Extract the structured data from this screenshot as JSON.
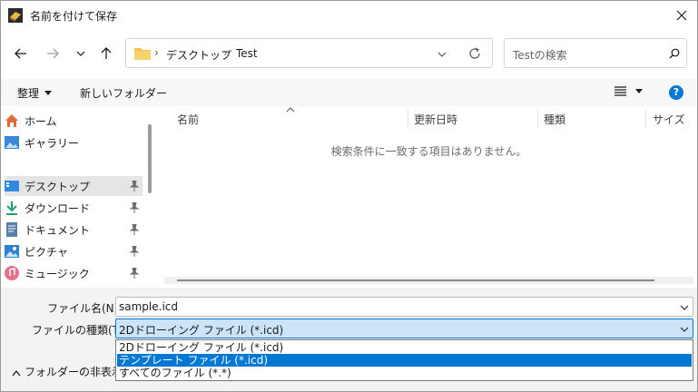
{
  "window": {
    "title": "名前を付けて保存",
    "close_icon": "close-icon"
  },
  "nav": {
    "address": {
      "segments": [
        "デスクトップ",
        "Test"
      ]
    },
    "search": {
      "placeholder": "Testの検索"
    }
  },
  "toolbar": {
    "organize_label": "整理",
    "new_folder_label": "新しいフォルダー"
  },
  "sidebar": {
    "items": [
      {
        "label": "ホーム",
        "icon": "home-icon",
        "pinned": false,
        "selected": false
      },
      {
        "label": "ギャラリー",
        "icon": "gallery-icon",
        "pinned": false,
        "selected": false
      },
      {
        "label": "デスクトップ",
        "icon": "desktop-icon",
        "pinned": true,
        "selected": true
      },
      {
        "label": "ダウンロード",
        "icon": "download-icon",
        "pinned": true,
        "selected": false
      },
      {
        "label": "ドキュメント",
        "icon": "document-icon",
        "pinned": true,
        "selected": false
      },
      {
        "label": "ピクチャ",
        "icon": "pictures-icon",
        "pinned": true,
        "selected": false
      },
      {
        "label": "ミュージック",
        "icon": "music-icon",
        "pinned": true,
        "selected": false
      }
    ]
  },
  "filelist": {
    "columns": [
      "名前",
      "更新日時",
      "種類",
      "サイズ"
    ],
    "empty_message": "検索条件に一致する項目はありません。"
  },
  "form": {
    "filename_label": "ファイル名(N):",
    "filename_value": "sample.icd",
    "filetype_label": "ファイルの種類(T):",
    "filetype_value": "2Dドローイング ファイル (*.icd)",
    "filetype_options": [
      {
        "label": "2Dドローイング ファイル (*.icd)",
        "selected": false
      },
      {
        "label": "テンプレート ファイル (*.icd)",
        "selected": true
      },
      {
        "label": "すべてのファイル (*.*)",
        "selected": false
      }
    ]
  },
  "footer": {
    "hide_folders_label": "フォルダーの非表示"
  },
  "colors": {
    "accent": "#0078d4",
    "selection_bg": "#cce4f7",
    "folder": "#f2c14e"
  }
}
